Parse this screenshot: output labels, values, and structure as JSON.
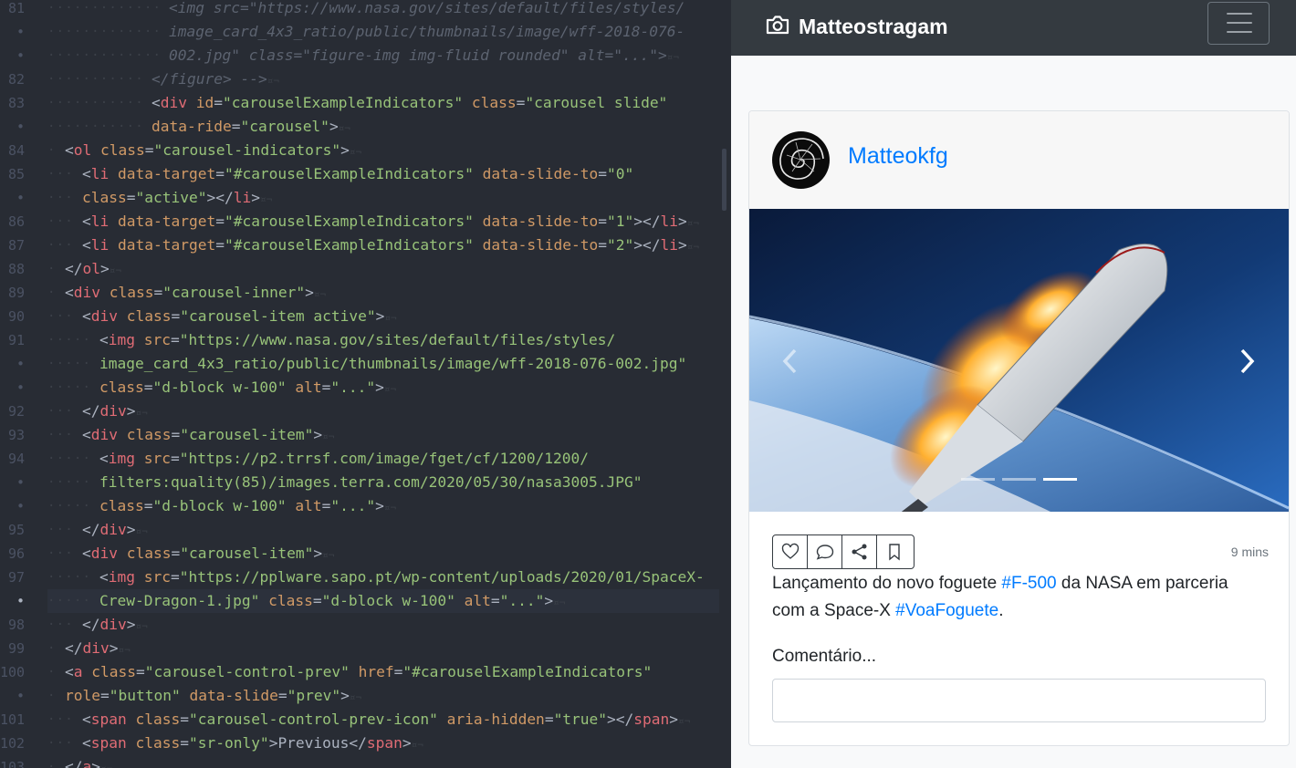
{
  "editor": {
    "lines": [
      {
        "ln": "81",
        "indent": 7,
        "segs": [
          [
            "t-comment",
            "<img src=\"https://www.nasa.gov/sites/default/files/styles/"
          ]
        ]
      },
      {
        "ln": "•",
        "indent": 7,
        "segs": [
          [
            "t-comment",
            "image_card_4x3_ratio/public/thumbnails/image/wff-2018-076-"
          ]
        ]
      },
      {
        "ln": "•",
        "indent": 7,
        "segs": [
          [
            "t-comment",
            "002.jpg\" class=\"figure-img img-fluid rounded\" alt=\"...\">"
          ],
          [
            "t-inv",
            "¤¬"
          ]
        ]
      },
      {
        "ln": "82",
        "indent": 6,
        "segs": [
          [
            "t-comment",
            "</figure> -->"
          ],
          [
            "t-inv",
            "¤¬"
          ]
        ]
      },
      {
        "ln": "83",
        "indent": 6,
        "segs": [
          [
            "t-punc",
            "<"
          ],
          [
            "t-tag",
            "div"
          ],
          [
            "t-attr",
            " id"
          ],
          [
            "t-punc",
            "="
          ],
          [
            "t-str",
            "\"carouselExampleIndicators\""
          ],
          [
            "t-attr",
            " class"
          ],
          [
            "t-punc",
            "="
          ],
          [
            "t-str",
            "\"carousel slide\""
          ]
        ]
      },
      {
        "ln": "•",
        "indent": 6,
        "segs": [
          [
            "t-attr",
            "data-ride"
          ],
          [
            "t-punc",
            "="
          ],
          [
            "t-str",
            "\"carousel\""
          ],
          [
            "t-punc",
            ">"
          ],
          [
            "t-inv",
            "¤¬"
          ]
        ]
      },
      {
        "ln": "84",
        "indent": 1,
        "segs": [
          [
            "t-punc",
            "<"
          ],
          [
            "t-tag",
            "ol"
          ],
          [
            "t-attr",
            " class"
          ],
          [
            "t-punc",
            "="
          ],
          [
            "t-str",
            "\"carousel-indicators\""
          ],
          [
            "t-punc",
            ">"
          ],
          [
            "t-inv",
            "¤¬"
          ]
        ]
      },
      {
        "ln": "85",
        "indent": 2,
        "segs": [
          [
            "t-punc",
            "<"
          ],
          [
            "t-tag",
            "li"
          ],
          [
            "t-attr",
            " data-target"
          ],
          [
            "t-punc",
            "="
          ],
          [
            "t-str",
            "\"#carouselExampleIndicators\""
          ],
          [
            "t-attr",
            " data-slide-to"
          ],
          [
            "t-punc",
            "="
          ],
          [
            "t-str",
            "\"0\""
          ]
        ]
      },
      {
        "ln": "•",
        "indent": 2,
        "segs": [
          [
            "t-attr",
            "class"
          ],
          [
            "t-punc",
            "="
          ],
          [
            "t-str",
            "\"active\""
          ],
          [
            "t-punc",
            "></"
          ],
          [
            "t-tag",
            "li"
          ],
          [
            "t-punc",
            ">"
          ],
          [
            "t-inv",
            "¤¬"
          ]
        ]
      },
      {
        "ln": "86",
        "indent": 2,
        "segs": [
          [
            "t-punc",
            "<"
          ],
          [
            "t-tag",
            "li"
          ],
          [
            "t-attr",
            " data-target"
          ],
          [
            "t-punc",
            "="
          ],
          [
            "t-str",
            "\"#carouselExampleIndicators\""
          ],
          [
            "t-attr",
            " data-slide-to"
          ],
          [
            "t-punc",
            "="
          ],
          [
            "t-str",
            "\"1\""
          ],
          [
            "t-punc",
            "></"
          ],
          [
            "t-tag",
            "li"
          ],
          [
            "t-punc",
            ">"
          ],
          [
            "t-inv",
            "¤¬"
          ]
        ]
      },
      {
        "ln": "87",
        "indent": 2,
        "segs": [
          [
            "t-punc",
            "<"
          ],
          [
            "t-tag",
            "li"
          ],
          [
            "t-attr",
            " data-target"
          ],
          [
            "t-punc",
            "="
          ],
          [
            "t-str",
            "\"#carouselExampleIndicators\""
          ],
          [
            "t-attr",
            " data-slide-to"
          ],
          [
            "t-punc",
            "="
          ],
          [
            "t-str",
            "\"2\""
          ],
          [
            "t-punc",
            "></"
          ],
          [
            "t-tag",
            "li"
          ],
          [
            "t-punc",
            ">"
          ],
          [
            "t-inv",
            "¤¬"
          ]
        ]
      },
      {
        "ln": "88",
        "indent": 1,
        "segs": [
          [
            "t-punc",
            "</"
          ],
          [
            "t-tag",
            "ol"
          ],
          [
            "t-punc",
            ">"
          ],
          [
            "t-inv",
            "¤¬"
          ]
        ]
      },
      {
        "ln": "89",
        "indent": 1,
        "segs": [
          [
            "t-punc",
            "<"
          ],
          [
            "t-tag",
            "div"
          ],
          [
            "t-attr",
            " class"
          ],
          [
            "t-punc",
            "="
          ],
          [
            "t-str",
            "\"carousel-inner\""
          ],
          [
            "t-punc",
            ">"
          ],
          [
            "t-inv",
            "¤¬"
          ]
        ]
      },
      {
        "ln": "90",
        "indent": 2,
        "segs": [
          [
            "t-punc",
            "<"
          ],
          [
            "t-tag",
            "div"
          ],
          [
            "t-attr",
            " class"
          ],
          [
            "t-punc",
            "="
          ],
          [
            "t-str",
            "\"carousel-item active\""
          ],
          [
            "t-punc",
            ">"
          ],
          [
            "t-inv",
            "¤¬"
          ]
        ]
      },
      {
        "ln": "91",
        "indent": 3,
        "segs": [
          [
            "t-punc",
            "<"
          ],
          [
            "t-tag",
            "img"
          ],
          [
            "t-attr",
            " src"
          ],
          [
            "t-punc",
            "="
          ],
          [
            "t-str",
            "\"https://www.nasa.gov/sites/default/files/styles/"
          ]
        ]
      },
      {
        "ln": "•",
        "indent": 3,
        "segs": [
          [
            "t-str",
            "image_card_4x3_ratio/public/thumbnails/image/wff-2018-076-002.jpg\""
          ]
        ]
      },
      {
        "ln": "•",
        "indent": 3,
        "segs": [
          [
            "t-attr",
            "class"
          ],
          [
            "t-punc",
            "="
          ],
          [
            "t-str",
            "\"d-block w-100\""
          ],
          [
            "t-attr",
            " alt"
          ],
          [
            "t-punc",
            "="
          ],
          [
            "t-str",
            "\"...\""
          ],
          [
            "t-punc",
            ">"
          ],
          [
            "t-inv",
            "¤¬"
          ]
        ]
      },
      {
        "ln": "92",
        "indent": 2,
        "segs": [
          [
            "t-punc",
            "</"
          ],
          [
            "t-tag",
            "div"
          ],
          [
            "t-punc",
            ">"
          ],
          [
            "t-inv",
            "¤¬"
          ]
        ]
      },
      {
        "ln": "93",
        "indent": 2,
        "segs": [
          [
            "t-punc",
            "<"
          ],
          [
            "t-tag",
            "div"
          ],
          [
            "t-attr",
            " class"
          ],
          [
            "t-punc",
            "="
          ],
          [
            "t-str",
            "\"carousel-item\""
          ],
          [
            "t-punc",
            ">"
          ],
          [
            "t-inv",
            "¤¬"
          ]
        ]
      },
      {
        "ln": "94",
        "indent": 3,
        "segs": [
          [
            "t-punc",
            "<"
          ],
          [
            "t-tag",
            "img"
          ],
          [
            "t-attr",
            " src"
          ],
          [
            "t-punc",
            "="
          ],
          [
            "t-str",
            "\"https://p2.trrsf.com/image/fget/cf/1200/1200/"
          ]
        ]
      },
      {
        "ln": "•",
        "indent": 3,
        "segs": [
          [
            "t-str",
            "filters:quality(85)/images.terra.com/2020/05/30/nasa3005.JPG\""
          ]
        ]
      },
      {
        "ln": "•",
        "indent": 3,
        "segs": [
          [
            "t-attr",
            "class"
          ],
          [
            "t-punc",
            "="
          ],
          [
            "t-str",
            "\"d-block w-100\""
          ],
          [
            "t-attr",
            " alt"
          ],
          [
            "t-punc",
            "="
          ],
          [
            "t-str",
            "\"...\""
          ],
          [
            "t-punc",
            ">"
          ],
          [
            "t-inv",
            "¤¬"
          ]
        ]
      },
      {
        "ln": "95",
        "indent": 2,
        "segs": [
          [
            "t-punc",
            "</"
          ],
          [
            "t-tag",
            "div"
          ],
          [
            "t-punc",
            ">"
          ],
          [
            "t-inv",
            "¤¬"
          ]
        ]
      },
      {
        "ln": "96",
        "indent": 2,
        "segs": [
          [
            "t-punc",
            "<"
          ],
          [
            "t-tag",
            "div"
          ],
          [
            "t-attr",
            " class"
          ],
          [
            "t-punc",
            "="
          ],
          [
            "t-str",
            "\"carousel-item\""
          ],
          [
            "t-punc",
            ">"
          ],
          [
            "t-inv",
            "¤¬"
          ]
        ]
      },
      {
        "ln": "97",
        "indent": 3,
        "segs": [
          [
            "t-punc",
            "<"
          ],
          [
            "t-tag",
            "img"
          ],
          [
            "t-attr",
            " src"
          ],
          [
            "t-punc",
            "="
          ],
          [
            "t-str",
            "\"https://pplware.sapo.pt/wp-content/uploads/2020/01/SpaceX-"
          ]
        ]
      },
      {
        "ln": "•",
        "indent": 3,
        "current": true,
        "segs": [
          [
            "t-str",
            "Crew-Dragon-1.jpg\""
          ],
          [
            "t-attr",
            " class"
          ],
          [
            "t-punc",
            "="
          ],
          [
            "t-str",
            "\"d-block w-100\""
          ],
          [
            "t-attr",
            " alt"
          ],
          [
            "t-punc",
            "="
          ],
          [
            "t-str",
            "\"...\""
          ],
          [
            "t-punc",
            ">"
          ],
          [
            "t-inv",
            "¤¬"
          ]
        ]
      },
      {
        "ln": "98",
        "indent": 2,
        "segs": [
          [
            "t-punc",
            "</"
          ],
          [
            "t-tag",
            "div"
          ],
          [
            "t-punc",
            ">"
          ],
          [
            "t-inv",
            "¤¬"
          ]
        ]
      },
      {
        "ln": "99",
        "indent": 1,
        "segs": [
          [
            "t-punc",
            "</"
          ],
          [
            "t-tag",
            "div"
          ],
          [
            "t-punc",
            ">"
          ],
          [
            "t-inv",
            "¤¬"
          ]
        ]
      },
      {
        "ln": "100",
        "indent": 1,
        "segs": [
          [
            "t-punc",
            "<"
          ],
          [
            "t-tag",
            "a"
          ],
          [
            "t-attr",
            " class"
          ],
          [
            "t-punc",
            "="
          ],
          [
            "t-str",
            "\"carousel-control-prev\""
          ],
          [
            "t-attr",
            " href"
          ],
          [
            "t-punc",
            "="
          ],
          [
            "t-str",
            "\"#carouselExampleIndicators\""
          ]
        ]
      },
      {
        "ln": "•",
        "indent": 1,
        "segs": [
          [
            "t-attr",
            "role"
          ],
          [
            "t-punc",
            "="
          ],
          [
            "t-str",
            "\"button\""
          ],
          [
            "t-attr",
            " data-slide"
          ],
          [
            "t-punc",
            "="
          ],
          [
            "t-str",
            "\"prev\""
          ],
          [
            "t-punc",
            ">"
          ],
          [
            "t-inv",
            "¤¬"
          ]
        ]
      },
      {
        "ln": "101",
        "indent": 2,
        "segs": [
          [
            "t-punc",
            "<"
          ],
          [
            "t-tag",
            "span"
          ],
          [
            "t-attr",
            " class"
          ],
          [
            "t-punc",
            "="
          ],
          [
            "t-str",
            "\"carousel-control-prev-icon\""
          ],
          [
            "t-attr",
            " aria-hidden"
          ],
          [
            "t-punc",
            "="
          ],
          [
            "t-str",
            "\"true\""
          ],
          [
            "t-punc",
            "></"
          ],
          [
            "t-tag",
            "span"
          ],
          [
            "t-punc",
            ">"
          ],
          [
            "t-inv",
            "¤¬"
          ]
        ]
      },
      {
        "ln": "102",
        "indent": 2,
        "segs": [
          [
            "t-punc",
            "<"
          ],
          [
            "t-tag",
            "span"
          ],
          [
            "t-attr",
            " class"
          ],
          [
            "t-punc",
            "="
          ],
          [
            "t-str",
            "\"sr-only\""
          ],
          [
            "t-punc",
            ">"
          ],
          [
            "t-text",
            "Previous"
          ],
          [
            "t-punc",
            "</"
          ],
          [
            "t-tag",
            "span"
          ],
          [
            "t-punc",
            ">"
          ],
          [
            "t-inv",
            "¤¬"
          ]
        ]
      },
      {
        "ln": "103",
        "indent": 1,
        "segs": [
          [
            "t-punc",
            "</"
          ],
          [
            "t-tag",
            "a"
          ],
          [
            "t-punc",
            ">"
          ],
          [
            "t-inv",
            "¤¬"
          ]
        ]
      }
    ]
  },
  "preview": {
    "navbar": {
      "brand": "Matteostragam",
      "brand_icon": "camera-icon",
      "toggler_icon": "hamburger-menu-icon"
    },
    "post": {
      "username": "Matteokfg",
      "avatar_icon": "nautilus-shell-icon",
      "carousel": {
        "indicator_count": 3,
        "active_index": 2,
        "prev_icon": "chevron-left-icon",
        "next_icon": "chevron-right-icon"
      },
      "actions": [
        {
          "name": "like",
          "icon": "heart-icon"
        },
        {
          "name": "comment",
          "icon": "comment-bubble-icon"
        },
        {
          "name": "share",
          "icon": "share-icon"
        },
        {
          "name": "save",
          "icon": "bookmark-icon"
        }
      ],
      "time": "9 mins",
      "caption": {
        "part1": "Lançamento do novo foguete ",
        "tag1": "#F-500",
        "part2": " da NASA em parceria com a Space-X ",
        "tag2": "#VoaFoguete",
        "part3": "."
      },
      "comment_label": "Comentário...",
      "comment_value": "",
      "comment_placeholder": ""
    }
  },
  "colors": {
    "editor_bg": "#282c34",
    "navbar_bg": "#343a40",
    "link": "#007bff",
    "tag": "#e06c75",
    "attr": "#d19a66",
    "string": "#98c379"
  }
}
